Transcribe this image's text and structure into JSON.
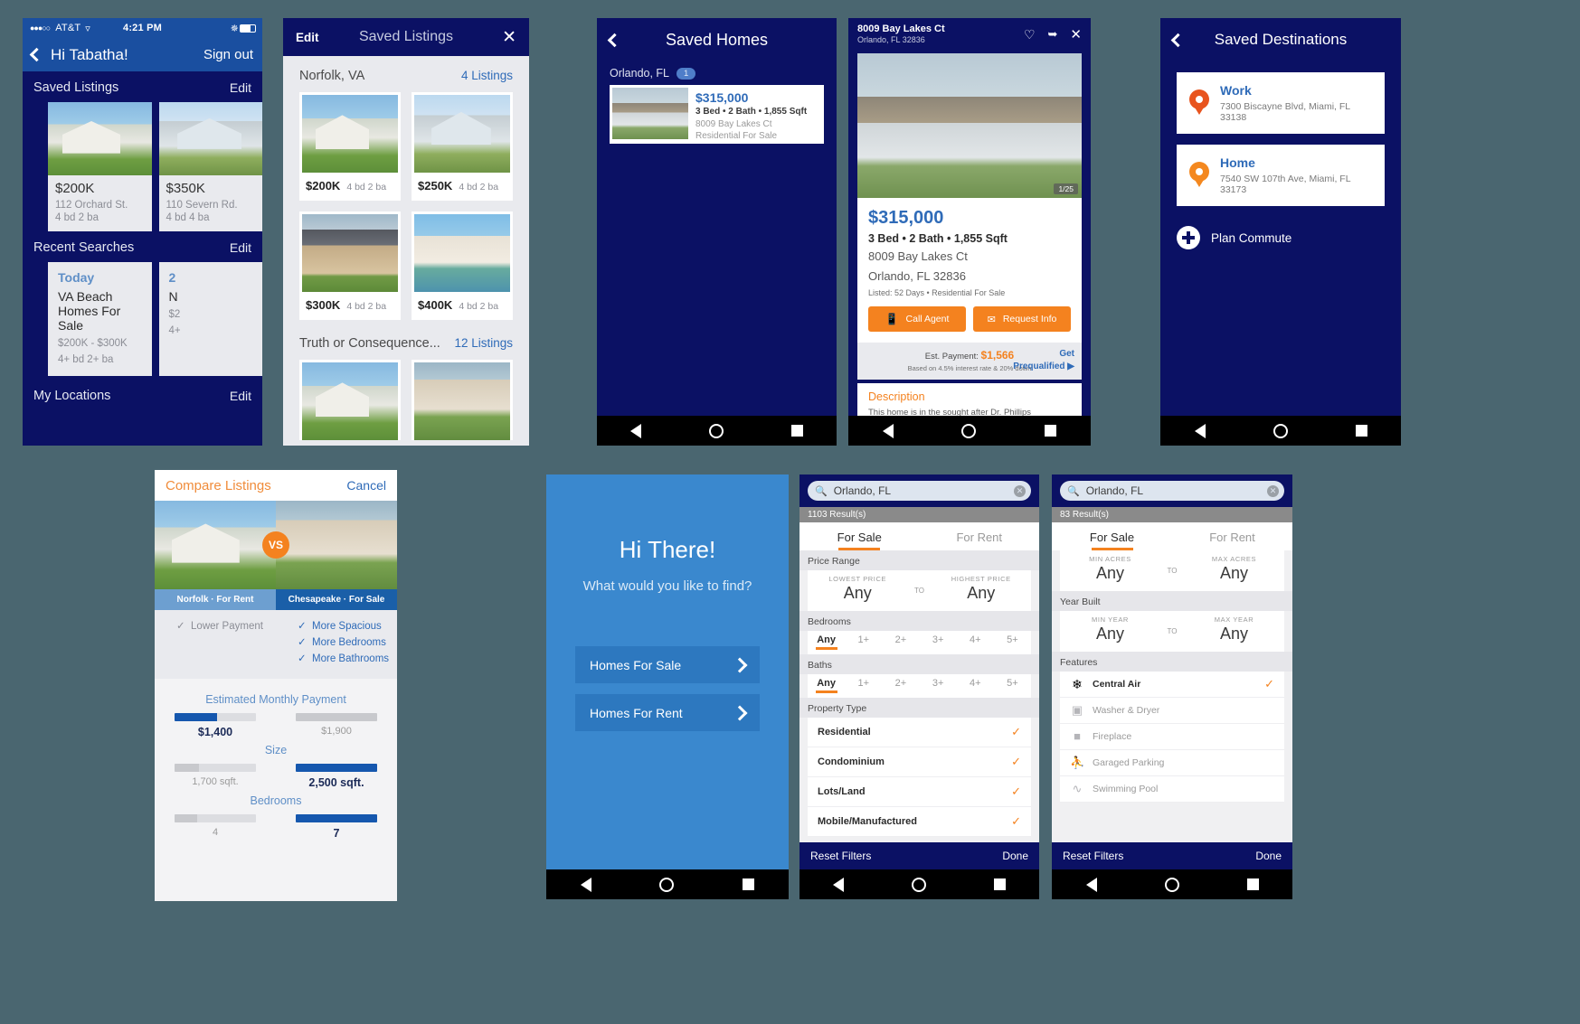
{
  "colors": {
    "navy": "#0b1164",
    "blue": "#1a4fa0",
    "accent_orange": "#f4821f",
    "link_blue": "#2f6bb8",
    "page_bg": "#4a6670"
  },
  "screen1": {
    "status": {
      "carrier": "AT&T",
      "dots": "●●●○○",
      "time": "4:21 PM"
    },
    "nav": {
      "back_icon": "chevron-left-icon",
      "title": "Hi Tabatha!",
      "right_action": "Sign out"
    },
    "sections": [
      {
        "title": "Saved Listings",
        "edit": "Edit"
      },
      {
        "title": "Recent Searches",
        "edit": "Edit"
      },
      {
        "title": "My Locations",
        "edit": "Edit"
      }
    ],
    "listings": [
      {
        "price": "$200K",
        "address": "112 Orchard St.",
        "beds": "4 bd   2 ba"
      },
      {
        "price": "$350K",
        "address": "110 Severn Rd.",
        "beds": "4 bd   4 ba"
      }
    ],
    "searches": [
      {
        "day": "Today",
        "query": "VA Beach Homes For Sale",
        "range": "$200K - $300K",
        "beds": "4+ bd    2+ ba"
      },
      {
        "day": "2",
        "query": "N",
        "range": "$2",
        "beds": "4+"
      }
    ]
  },
  "screen2": {
    "nav": {
      "edit": "Edit",
      "title": "Saved Listings",
      "close_icon": "close-icon"
    },
    "groups": [
      {
        "location": "Norfolk, VA",
        "count": "4 Listings",
        "cards": [
          {
            "price": "$200K",
            "bb": "4 bd    2 ba"
          },
          {
            "price": "$250K",
            "bb": "4 bd    2 ba"
          },
          {
            "price": "$300K",
            "bb": "4 bd    2 ba"
          },
          {
            "price": "$400K",
            "bb": "4 bd    2 ba"
          }
        ]
      },
      {
        "location": "Truth or Consequence...",
        "count": "12 Listings",
        "cards": [
          {
            "price": "",
            "bb": ""
          },
          {
            "price": "",
            "bb": ""
          }
        ]
      }
    ]
  },
  "screen3": {
    "nav": {
      "back_icon": "chevron-left-icon",
      "title": "Saved Homes"
    },
    "location": "Orlando, FL",
    "badge": "1",
    "card": {
      "price": "$315,000",
      "spec": "3 Bed • 2 Bath • 1,855 Sqft",
      "address": "8009 Bay Lakes Ct",
      "type": "Residential For Sale"
    }
  },
  "screen4": {
    "nav": {
      "address_line1": "8009 Bay Lakes Ct",
      "address_line2": "Orlando, FL 32836",
      "heart_icon": "heart-icon",
      "share_icon": "share-icon",
      "close_icon": "close-icon"
    },
    "photo_count": "1/25",
    "price": "$315,000",
    "spec": "3 Bed • 2 Bath • 1,855 Sqft",
    "address_line1": "8009 Bay Lakes Ct",
    "address_line2": "Orlando, FL 32836",
    "listed": "Listed: 52 Days • Residential For Sale",
    "buttons": [
      {
        "label": "Call Agent",
        "icon": "phone-icon"
      },
      {
        "label": "Request Info",
        "icon": "mail-icon"
      }
    ],
    "payment": {
      "label": "Est. Payment:",
      "value": "$1,566",
      "note": "Based on 4.5% interest rate & 20% down",
      "prequalify_line1": "Get",
      "prequalify_line2": "Prequalified ▶"
    },
    "description": {
      "title": "Description",
      "text": "This home is in the sought after Dr. Phillips community"
    }
  },
  "screen5": {
    "nav": {
      "back_icon": "chevron-left-icon",
      "title": "Saved Destinations"
    },
    "destinations": [
      {
        "name": "Work",
        "address": "7300 Biscayne Blvd, Miami, FL 33138",
        "pin_color": "#e8541e"
      },
      {
        "name": "Home",
        "address": "7540 SW 107th Ave, Miami, FL 33173",
        "pin_color": "#f4881f"
      }
    ],
    "plan_commute": {
      "label": "Plan Commute",
      "icon": "plus-circle-icon"
    }
  },
  "screen6": {
    "header": {
      "title": "Compare Listings",
      "cancel": "Cancel"
    },
    "vs_badge": "VS",
    "tabs": [
      {
        "label": "Norfolk  ·  For Rent"
      },
      {
        "label": "Chesapeake  ·  For Sale"
      }
    ],
    "features": {
      "left": [
        "Lower Payment"
      ],
      "right": [
        "More Spacious",
        "More Bedrooms",
        "More Bathrooms"
      ]
    },
    "comparisons": [
      {
        "title": "Estimated Monthly Payment",
        "left": {
          "value": "$1,400",
          "pct": 52,
          "winner": true
        },
        "right": {
          "value": "$1,900",
          "pct": 100,
          "winner": false
        }
      },
      {
        "title": "Size",
        "left": {
          "value": "1,700 sqft.",
          "pct": 30,
          "winner": false
        },
        "right": {
          "value": "2,500 sqft.",
          "pct": 100,
          "winner": true
        }
      },
      {
        "title": "Bedrooms",
        "left": {
          "value": "4",
          "pct": 28,
          "winner": false
        },
        "right": {
          "value": "7",
          "pct": 100,
          "winner": true
        }
      }
    ]
  },
  "screen7": {
    "title": "Hi There!",
    "subtitle": "What would you like to find?",
    "options": [
      {
        "label": "Homes For Sale",
        "icon": "chevron-right-icon"
      },
      {
        "label": "Homes For Rent",
        "icon": "chevron-right-icon"
      }
    ]
  },
  "screen8": {
    "search": {
      "value": "Orlando, FL",
      "icon": "search-icon",
      "clear_icon": "clear-icon"
    },
    "results": "1103 Result(s)",
    "tabs": [
      {
        "label": "For Sale",
        "active": true
      },
      {
        "label": "For Rent",
        "active": false
      }
    ],
    "price_range": {
      "label": "Price Range",
      "low_caption": "LOWEST PRICE",
      "low_value": "Any",
      "to": "TO",
      "high_caption": "HIGHEST PRICE",
      "high_value": "Any"
    },
    "bedrooms": {
      "label": "Bedrooms",
      "options": [
        "Any",
        "1+",
        "2+",
        "3+",
        "4+",
        "5+"
      ],
      "selected": "Any"
    },
    "baths": {
      "label": "Baths",
      "options": [
        "Any",
        "1+",
        "2+",
        "3+",
        "4+",
        "5+"
      ],
      "selected": "Any"
    },
    "property_type": {
      "label": "Property Type",
      "options": [
        {
          "label": "Residential",
          "checked": true
        },
        {
          "label": "Condominium",
          "checked": true
        },
        {
          "label": "Lots/Land",
          "checked": true
        },
        {
          "label": "Mobile/Manufactured",
          "checked": true
        }
      ]
    },
    "footer": {
      "reset": "Reset Filters",
      "done": "Done"
    }
  },
  "screen9": {
    "search": {
      "value": "Orlando, FL",
      "icon": "search-icon",
      "clear_icon": "clear-icon"
    },
    "results": "83 Result(s)",
    "tabs": [
      {
        "label": "For Sale",
        "active": true
      },
      {
        "label": "For Rent",
        "active": false
      }
    ],
    "acres": {
      "min_caption": "MIN ACRES",
      "min_value": "Any",
      "to": "TO",
      "max_caption": "MAX ACRES",
      "max_value": "Any"
    },
    "year_built": {
      "label": "Year Built",
      "min_caption": "MIN YEAR",
      "min_value": "Any",
      "to": "TO",
      "max_caption": "MAX YEAR",
      "max_value": "Any"
    },
    "features": {
      "label": "Features",
      "items": [
        {
          "label": "Central Air",
          "icon": "snowflake-icon",
          "checked": true
        },
        {
          "label": "Washer & Dryer",
          "icon": "washer-icon",
          "checked": false
        },
        {
          "label": "Fireplace",
          "icon": "fireplace-icon",
          "checked": false
        },
        {
          "label": "Garaged Parking",
          "icon": "garage-icon",
          "checked": false
        },
        {
          "label": "Swimming Pool",
          "icon": "pool-icon",
          "checked": false
        }
      ]
    },
    "footer": {
      "reset": "Reset Filters",
      "done": "Done"
    }
  }
}
